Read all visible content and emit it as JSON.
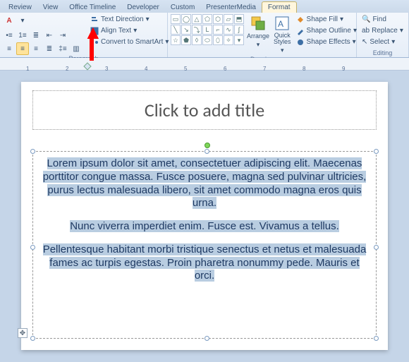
{
  "tabs": {
    "review": "Review",
    "view": "View",
    "timeline": "Office Timeline",
    "developer": "Developer",
    "custom": "Custom",
    "presentermedia": "PresenterMedia",
    "format": "Format"
  },
  "ribbon": {
    "paragraph": {
      "label": "Paragraph",
      "textdir": "Text Direction",
      "align": "Align Text",
      "smartart": "Convert to SmartArt"
    },
    "drawing": {
      "label": "Drawing",
      "arrange": "Arrange",
      "quick": "Quick\nStyles",
      "fill": "Shape Fill",
      "outline": "Shape Outline",
      "effects": "Shape Effects"
    },
    "editing": {
      "label": "Editing",
      "find": "Find",
      "replace": "Replace",
      "select": "Select"
    }
  },
  "ruler": {
    "nums": [
      "1",
      "2",
      "3",
      "4",
      "5",
      "6",
      "7",
      "8",
      "9"
    ]
  },
  "slide": {
    "title_placeholder": "Click to add title",
    "p1": "Lorem ipsum dolor sit amet, consectetuer adipiscing elit. Maecenas porttitor congue massa. Fusce posuere, magna sed pulvinar ultricies, purus lectus malesuada libero, sit amet commodo magna eros quis urna.",
    "p2": "Nunc viverra imperdiet enim. Fusce est. Vivamus a tellus.",
    "p3": "Pellentesque habitant morbi tristique senectus et netus et malesuada fames ac turpis egestas. Proin pharetra nonummy pede. Mauris et orci."
  }
}
